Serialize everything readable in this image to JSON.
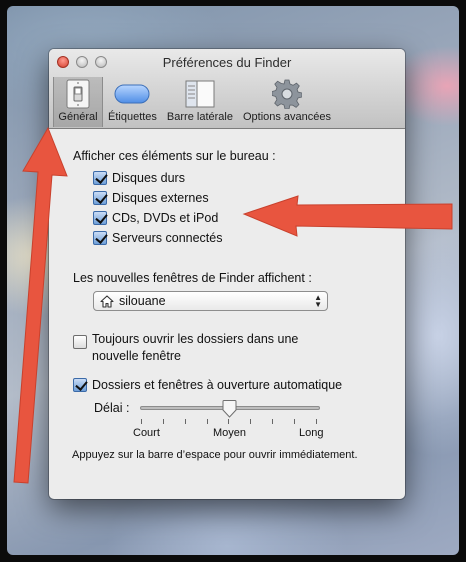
{
  "window": {
    "title": "Préférences du Finder"
  },
  "toolbar": {
    "tabs": [
      {
        "label": "Général",
        "icon": "switch-icon",
        "active": true
      },
      {
        "label": "Étiquettes",
        "icon": "label-pill-icon",
        "active": false
      },
      {
        "label": "Barre latérale",
        "icon": "sidebar-icon",
        "active": false
      },
      {
        "label": "Options avancées",
        "icon": "gear-icon",
        "active": false
      }
    ]
  },
  "desktop_items": {
    "heading": "Afficher ces éléments sur le bureau :",
    "items": [
      {
        "label": "Disques durs",
        "checked": true
      },
      {
        "label": "Disques externes",
        "checked": true
      },
      {
        "label": "CDs, DVDs et iPod",
        "checked": true
      },
      {
        "label": "Serveurs connectés",
        "checked": true
      }
    ]
  },
  "new_windows": {
    "label": "Les nouvelles fenêtres de Finder affichent :",
    "selected": "silouane",
    "icon": "home-icon"
  },
  "always_open": {
    "label_line1": "Toujours ouvrir les dossiers dans une",
    "label_line2": "nouvelle fenêtre",
    "checked": false
  },
  "spring_loaded": {
    "label": "Dossiers et fenêtres à ouverture automatique",
    "checked": true,
    "delay_label": "Délai :",
    "delay_value": 0.5,
    "scale_short": "Court",
    "scale_medium": "Moyen",
    "scale_long": "Long",
    "hint": "Appuyez sur la barre d’espace pour ouvrir immédiatement."
  },
  "colors": {
    "annotation_arrow": "#e8553f",
    "checkbox_checked": "#6e9fd8"
  }
}
